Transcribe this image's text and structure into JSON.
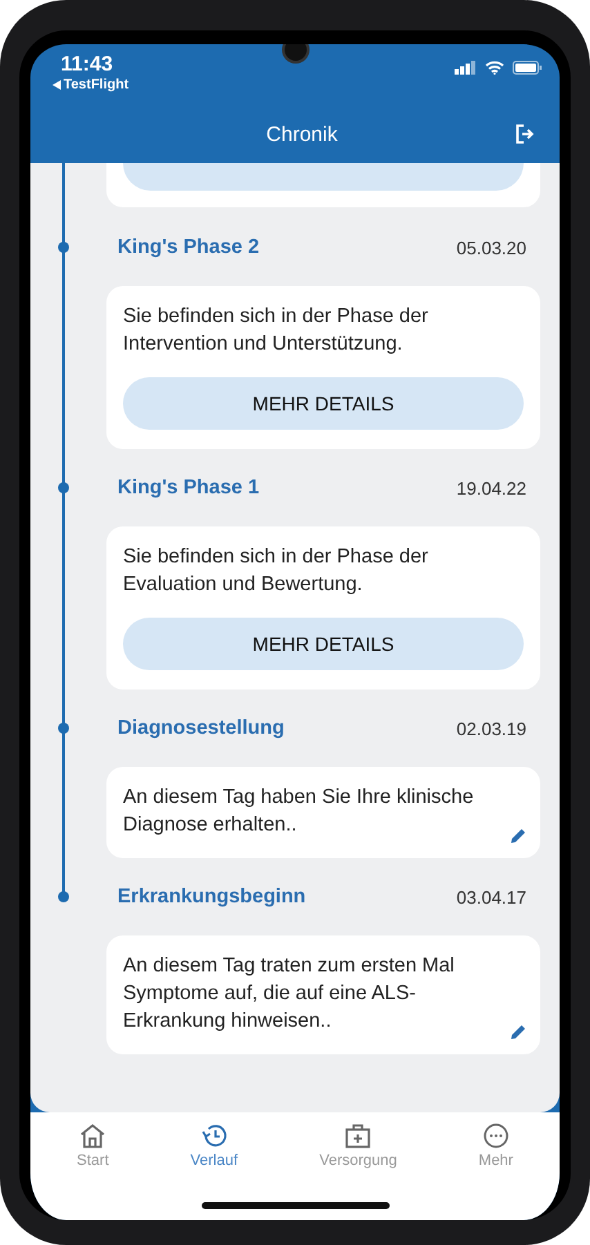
{
  "status_bar": {
    "time": "11:43",
    "back_app": "TestFlight"
  },
  "header": {
    "title": "Chronik"
  },
  "timeline": [
    {
      "kind": "details",
      "title": "King's Phase 2",
      "date": "05.03.20",
      "text": "Sie befinden sich in der Phase der Intervention und Unterstützung.",
      "button": "MEHR DETAILS"
    },
    {
      "kind": "details",
      "title": "King's Phase 1",
      "date": "19.04.22",
      "text": "Sie befinden sich in der Phase der Evaluation und Bewertung.",
      "button": "MEHR DETAILS"
    },
    {
      "kind": "editable",
      "title": "Diagnosestellung",
      "date": "02.03.19",
      "text": "An diesem Tag haben Sie Ihre klinische Diagnose erhalten.."
    },
    {
      "kind": "editable",
      "title": "Erkrankungsbeginn",
      "date": "03.04.17",
      "text": "An diesem Tag traten zum ersten Mal Symptome auf, die auf eine ALS-Erkrankung hinweisen.."
    }
  ],
  "tab_bar": [
    {
      "label": "Start",
      "selected": false
    },
    {
      "label": "Verlauf",
      "selected": true
    },
    {
      "label": "Versorgung",
      "selected": false
    },
    {
      "label": "Mehr",
      "selected": false
    }
  ]
}
